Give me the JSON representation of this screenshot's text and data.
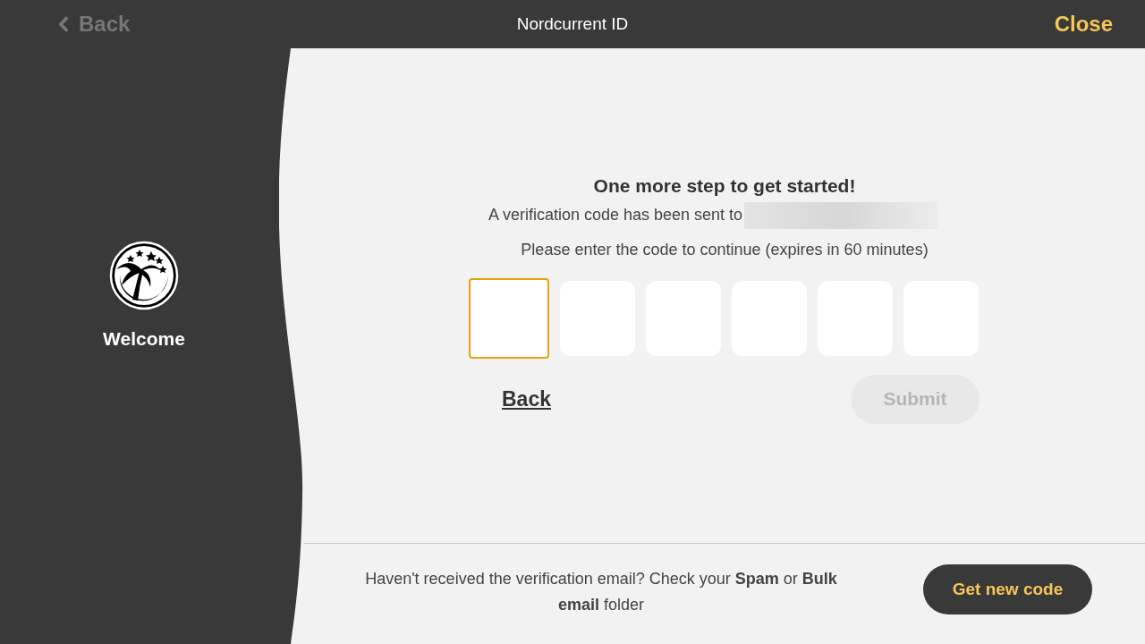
{
  "header": {
    "back": "Back",
    "title": "Nordcurrent ID",
    "close": "Close"
  },
  "sidebar": {
    "welcome": "Welcome"
  },
  "verify": {
    "heading": "One more step to get started!",
    "sent_to": "A verification code has been sent to",
    "instruction": "Please enter the code to continue (expires in 60 minutes)",
    "code_boxes": [
      {
        "focused": true
      },
      {
        "focused": false
      },
      {
        "focused": false
      },
      {
        "focused": false
      },
      {
        "focused": false
      },
      {
        "focused": false
      }
    ],
    "back": "Back",
    "submit": {
      "label": "Submit",
      "disabled": true
    }
  },
  "footer": {
    "note": "Haven't received the verification email? Check your **Spam** or **Bulk email** folder",
    "button": "Get new code"
  }
}
